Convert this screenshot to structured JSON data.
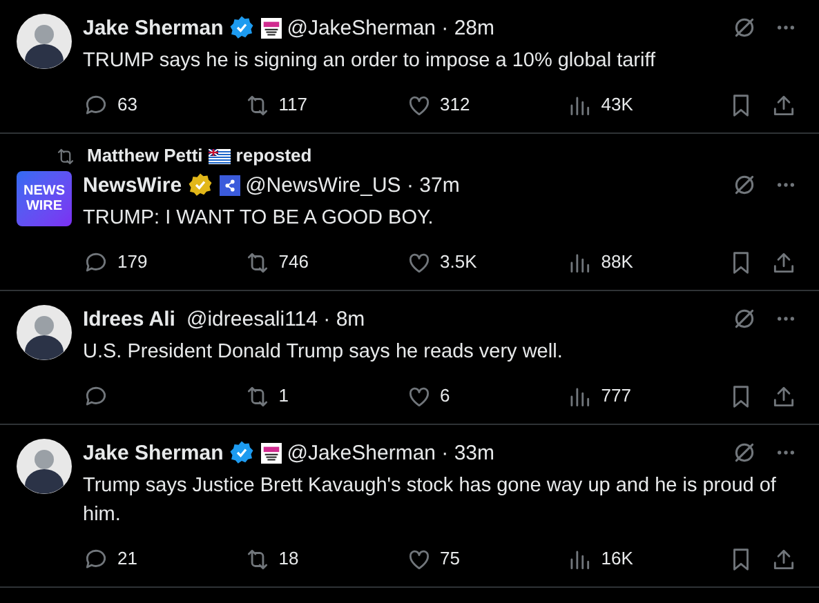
{
  "tweets": [
    {
      "avatar": {
        "kind": "photo"
      },
      "name": "Jake Sherman",
      "verified": {
        "color": "#1d9bf0"
      },
      "affiliate": {
        "kind": "newspaper"
      },
      "handle": "@JakeSherman · 28m",
      "text": "TRUMP says he is signing an order to impose a 10% global tariff",
      "replies": "63",
      "reposts": "117",
      "likes": "312",
      "views": "43K"
    },
    {
      "repost": {
        "name": "Matthew Petti",
        "label": "reposted"
      },
      "avatar": {
        "kind": "logo",
        "text": "NEWS WIRE"
      },
      "name": "NewsWire",
      "verified": {
        "color": "#e2b719"
      },
      "affiliate": {
        "kind": "network"
      },
      "handle": "@NewsWire_US · 37m",
      "text": "TRUMP: I WANT TO BE A GOOD BOY.",
      "replies": "179",
      "reposts": "746",
      "likes": "3.5K",
      "views": "88K"
    },
    {
      "avatar": {
        "kind": "photo"
      },
      "name": "Idrees Ali",
      "handle": "@idreesali114 · 8m",
      "text": "U.S. President Donald Trump says he reads very well.",
      "reposts": "1",
      "likes": "6",
      "views": "777"
    },
    {
      "avatar": {
        "kind": "photo"
      },
      "name": "Jake Sherman",
      "verified": {
        "color": "#1d9bf0"
      },
      "affiliate": {
        "kind": "newspaper"
      },
      "handle": "@JakeSherman · 33m",
      "text": "Trump says Justice Brett Kavaugh's stock has gone way up and he is proud of him.",
      "replies": "21",
      "reposts": "18",
      "likes": "75",
      "views": "16K"
    }
  ]
}
